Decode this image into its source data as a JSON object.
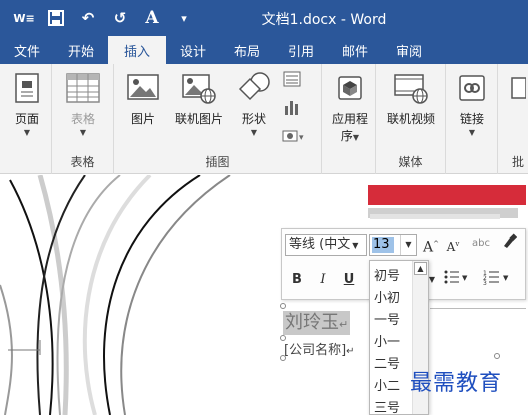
{
  "window": {
    "title": "文档1.docx - Word",
    "qat": {
      "word_icon": "W",
      "save_icon": "save-icon",
      "undo_icon": "↶",
      "redo_icon": "↺",
      "format_icon": "A",
      "customize_icon": "▾"
    }
  },
  "tabs": [
    "文件",
    "开始",
    "插入",
    "设计",
    "布局",
    "引用",
    "邮件",
    "审阅"
  ],
  "active_tab": "插入",
  "ribbon": {
    "pages": {
      "label": "页面",
      "group": ""
    },
    "tables": {
      "label": "表格",
      "group": "表格"
    },
    "illustrations": {
      "group": "插图",
      "picture": "图片",
      "online_picture": "联机图片",
      "shapes": "形状"
    },
    "addins": {
      "label1": "应用程",
      "label2": "序",
      "group": ""
    },
    "media": {
      "online_video": "联机视频",
      "group": "媒体"
    },
    "links": {
      "label": "链接",
      "group": ""
    },
    "cut_group": "批"
  },
  "mini_toolbar": {
    "font_name": "等线 (中文",
    "font_size": "13",
    "grow": "A",
    "shrink": "A",
    "pinyin": "abc",
    "bold": "B",
    "italic": "I",
    "underline": "U"
  },
  "size_dropdown": {
    "items": [
      "初号",
      "小初",
      "一号",
      "小一",
      "二号",
      "小二",
      "三号"
    ]
  },
  "document": {
    "name": "刘玲玉",
    "company": "[公司名称]"
  },
  "watermark": "最需教育",
  "colors": {
    "accent": "#2b579a",
    "ribbon_bg": "#f3f3f3",
    "red_block": "#d62c3a",
    "watermark": "#1f4fbf"
  }
}
